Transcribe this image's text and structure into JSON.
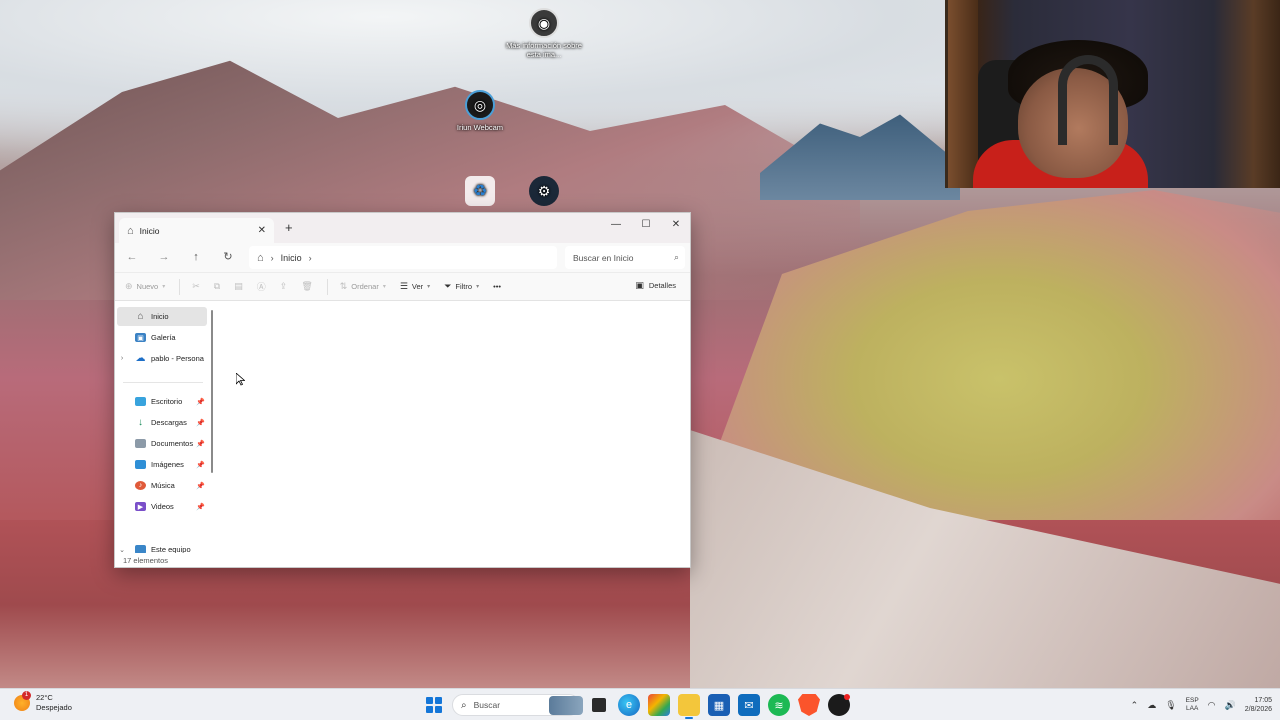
{
  "desktop": {
    "icons": [
      {
        "label": "Más información sobre esta ima...",
        "icon": "spotlight-icon"
      },
      {
        "label": "Iriun Webcam",
        "icon": "webcam-app-icon"
      },
      {
        "label": "",
        "icon": "recycle-bin-icon"
      },
      {
        "label": "",
        "icon": "steam-icon"
      }
    ]
  },
  "explorer": {
    "tab_title": "Inicio",
    "new_tab": "+",
    "window_buttons": {
      "minimize": "—",
      "maximize": "☐",
      "close": "✕"
    },
    "address": {
      "crumb": "Inicio"
    },
    "search_placeholder": "Buscar en Inicio",
    "toolbar": {
      "new": "Nuevo",
      "sort": "Ordenar",
      "view": "Ver",
      "filter": "Filtro",
      "more": "•••",
      "details": "Detalles"
    },
    "sidebar": {
      "items": [
        {
          "label": "Inicio",
          "icon": "home-icon",
          "selected": true
        },
        {
          "label": "Galería",
          "icon": "gallery-icon"
        },
        {
          "label": "pablo - Persona",
          "icon": "onedrive-icon",
          "expandable": true
        },
        {
          "label": "Escritorio",
          "icon": "desktop-folder-icon",
          "pinned": true
        },
        {
          "label": "Descargas",
          "icon": "downloads-icon",
          "pinned": true
        },
        {
          "label": "Documentos",
          "icon": "documents-icon",
          "pinned": true
        },
        {
          "label": "Imágenes",
          "icon": "pictures-icon",
          "pinned": true
        },
        {
          "label": "Música",
          "icon": "music-icon",
          "pinned": true
        },
        {
          "label": "Videos",
          "icon": "videos-icon",
          "pinned": true
        },
        {
          "label": "Este equipo",
          "icon": "this-pc-icon",
          "expanded": true
        }
      ]
    },
    "status": "17 elementos"
  },
  "taskbar": {
    "weather": {
      "temp": "22°C",
      "condition": "Despejado",
      "badge": "1"
    },
    "search_placeholder": "Buscar",
    "tray": {
      "lang_top": "ESP",
      "lang_bottom": "LAA",
      "time": "17:05",
      "date": "2/8/2026"
    }
  },
  "colors": {
    "accent": "#1476d8",
    "taskbar_bg": "#eef0f4",
    "window_chrome": "#f2eef0"
  }
}
